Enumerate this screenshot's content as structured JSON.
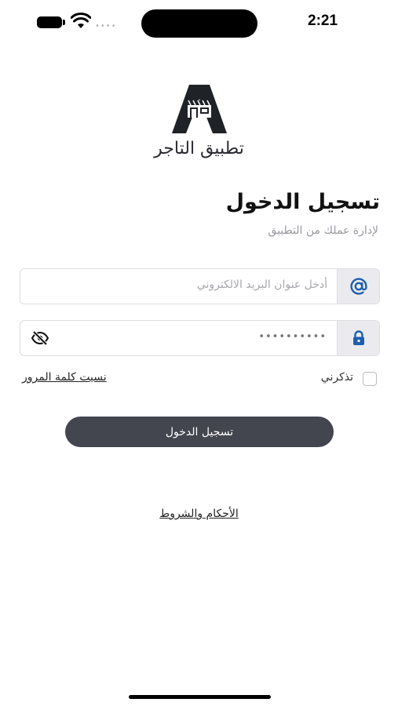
{
  "status_bar": {
    "time": "2:21",
    "signal_dots": "••••"
  },
  "app": {
    "name": "تطبيق التاجر"
  },
  "login": {
    "title": "تسجيل الدخول",
    "subtitle": "لإدارة عملك من التطبيق",
    "email_placeholder": "أدخل عنوان البريد الالكتروني",
    "password_mask": "••••••••••",
    "remember_label": "تذكرني",
    "remember_checked": false,
    "forgot_label": "نسيت كلمة المرور",
    "submit_label": "تسجيل الدخول",
    "terms_label": "الأحكام والشروط"
  },
  "icons": {
    "email": "at-icon",
    "password": "lock-icon",
    "toggle_visibility": "eye-off-icon"
  },
  "colors": {
    "primary": "#43454f",
    "accent_icon": "#1d5fb0",
    "icon_box": "#ebebef"
  }
}
